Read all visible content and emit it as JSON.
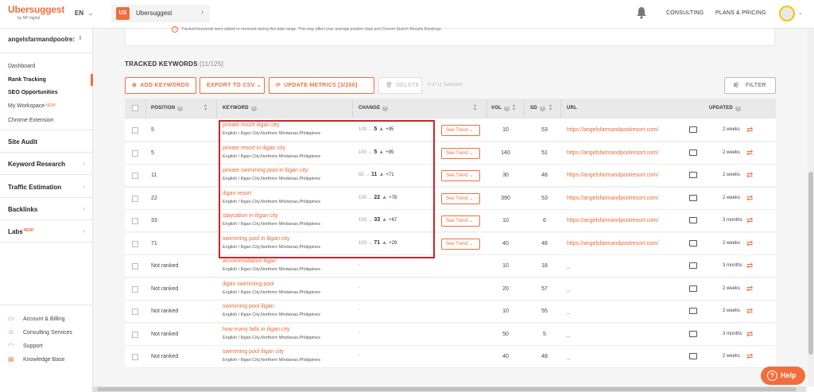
{
  "header": {
    "logo": "Ubersuggest",
    "logo_sub": "by NP digital",
    "lang": "EN",
    "project_badge": "US",
    "project_name": "Ubersuggest",
    "consulting": "CONSULTING",
    "plans": "PLANS & PRICING"
  },
  "sidebar": {
    "account": "angelsfarmandpoolre:",
    "items": [
      "Dashboard",
      "Rank Tracking",
      "SEO Opportunities",
      "My Workspace",
      "Chrome Extension"
    ],
    "new_tag": "NEW!",
    "sections": [
      "Site Audit",
      "Keyword Research",
      "Traffic Estimation",
      "Backlinks",
      "Labs"
    ],
    "bottom": [
      "Account & Billing",
      "Consulting Services",
      "Support",
      "Knowledge Base"
    ]
  },
  "notice": "Tracked keywords were added or removed during this date range. This may affect your average position data and Current Search Results Rankings.",
  "tracked": {
    "title": "TRACKED KEYWORDS",
    "count": "[11/125]",
    "add": "ADD KEYWORDS",
    "export": "EXPORT TO CSV",
    "update": "UPDATE METRICS [3/200]",
    "delete": "DELETE",
    "selected": "0 of 11 Selected",
    "filter": "FILTER"
  },
  "columns": {
    "position": "POSITION",
    "keyword": "KEYWORD",
    "change": "CHANGE",
    "vol": "VOL",
    "sd": "SD",
    "url": "URL",
    "updated": "UPDATED"
  },
  "see_trend": "See Trend",
  "rows": [
    {
      "pos": "5",
      "kw": "private resort iligan city",
      "loc": "English / Iligan City,Northern Mindanao,Philippines",
      "from": "100",
      "to": "5",
      "delta": "+95",
      "vol": "10",
      "sd": "53",
      "url": "https://angelsfarmandpoolresort.com/",
      "upd": "2 weeks"
    },
    {
      "pos": "5",
      "kw": "private resort in iligan city",
      "loc": "English / Iligan City,Northern Mindanao,Philippines",
      "from": "100",
      "to": "5",
      "delta": "+95",
      "vol": "140",
      "sd": "51",
      "url": "https://angelsfarmandpoolresort.com/",
      "upd": "2 weeks"
    },
    {
      "pos": "11",
      "kw": "private swimming pool in iligan city",
      "loc": "English / Iligan City,Northern Mindanao,Philippines",
      "from": "82",
      "to": "11",
      "delta": "+71",
      "vol": "30",
      "sd": "48",
      "url": "https://angelsfarmandpoolresort.com/",
      "upd": "2 weeks"
    },
    {
      "pos": "22",
      "kw": "iligan resort",
      "loc": "English / Iligan City,Northern Mindanao,Philippines",
      "from": "100",
      "to": "22",
      "delta": "+78",
      "vol": "390",
      "sd": "53",
      "url": "https://angelsfarmandpoolresort.com/",
      "upd": "2 weeks"
    },
    {
      "pos": "33",
      "kw": "staycation in iligan city",
      "loc": "English / Iligan City,Northern Mindanao,Philippines",
      "from": "100",
      "to": "33",
      "delta": "+67",
      "vol": "10",
      "sd": "6",
      "url": "https://angelsfarmandpoolresort.com/",
      "upd": "3 months"
    },
    {
      "pos": "71",
      "kw": "swimming pool in iligan city",
      "loc": "English / Iligan City,Northern Mindanao,Philippines",
      "from": "100",
      "to": "71",
      "delta": "+29",
      "vol": "40",
      "sd": "48",
      "url": "https://angelsfarmandpoolresort.com/",
      "upd": "2 weeks"
    },
    {
      "pos": "Not ranked",
      "kw": "accommodation iligan",
      "loc": "English / Iligan City,Northern Mindanao,Philippines",
      "dash": "-",
      "vol": "10",
      "sd": "18",
      "url": "_",
      "upd": "3 months"
    },
    {
      "pos": "Not ranked",
      "kw": "iligan swimming pool",
      "loc": "English / Iligan City,Northern Mindanao,Philippines",
      "dash": "-",
      "vol": "20",
      "sd": "57",
      "url": "_",
      "upd": "2 weeks"
    },
    {
      "pos": "Not ranked",
      "kw": "swimming pool iligan",
      "loc": "English / Iligan City,Northern Mindanao,Philippines",
      "dash": "-",
      "vol": "10",
      "sd": "55",
      "url": "_",
      "upd": "2 weeks"
    },
    {
      "pos": "Not ranked",
      "kw": "how many falls in iligan city",
      "loc": "English / Iligan City,Northern Mindanao,Philippines",
      "dash": "-",
      "vol": "50",
      "sd": "5",
      "url": "_",
      "upd": "3 months"
    },
    {
      "pos": "Not ranked",
      "kw": "swimming pool iligan city",
      "loc": "English / Iligan City,Northern Mindanao,Philippines",
      "dash": "-",
      "vol": "40",
      "sd": "48",
      "url": "_",
      "upd": "2 weeks"
    }
  ],
  "help": "Help",
  "colors": {
    "accent": "#f26d3d",
    "highlight": "#d42026",
    "up": "#4fb07a"
  }
}
